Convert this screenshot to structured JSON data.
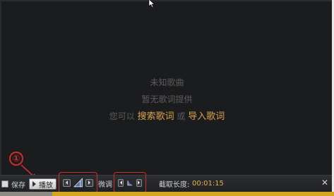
{
  "lyrics": {
    "song_status": "未知歌曲",
    "no_lyrics": "暂无歌词提供",
    "prompt_prefix": "您可以",
    "search_link": "搜索歌词",
    "or": "或",
    "import_link": "导入歌词"
  },
  "annotation": {
    "number": "①"
  },
  "toolbar": {
    "save_label": "保存",
    "play_label": "播放",
    "tune_label": "微调",
    "duration_label": "截取长度:",
    "duration_value": "00:01:15",
    "close_symbol": "✕"
  },
  "colors": {
    "background": "#1b1c1e",
    "link": "#d7a347",
    "annotation": "#d42b2b",
    "accent_strip": "#d4a51f"
  }
}
